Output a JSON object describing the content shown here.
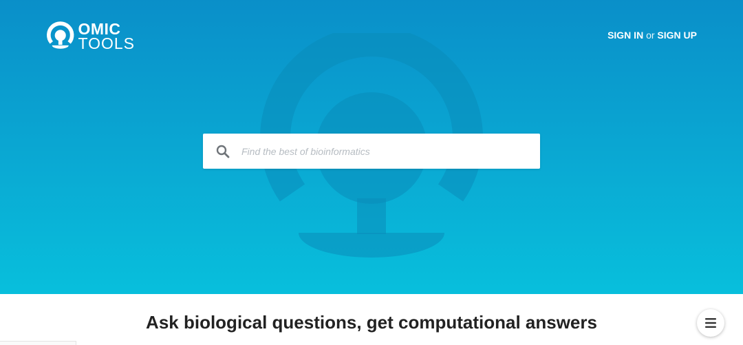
{
  "brand": {
    "line1": "OMIC",
    "line2": "TOOLS",
    "logo_icon": "omega-icon",
    "accent_color": "#0aa9d3"
  },
  "header": {
    "sign_in_label": "SIGN IN",
    "or_label": "or",
    "sign_up_label": "SIGN UP"
  },
  "search": {
    "placeholder": "Find the best of bioinformatics",
    "value": "",
    "icon": "search-icon"
  },
  "main": {
    "tagline": "Ask biological questions, get computational answers"
  },
  "fab": {
    "icon": "hamburger-menu-icon"
  }
}
